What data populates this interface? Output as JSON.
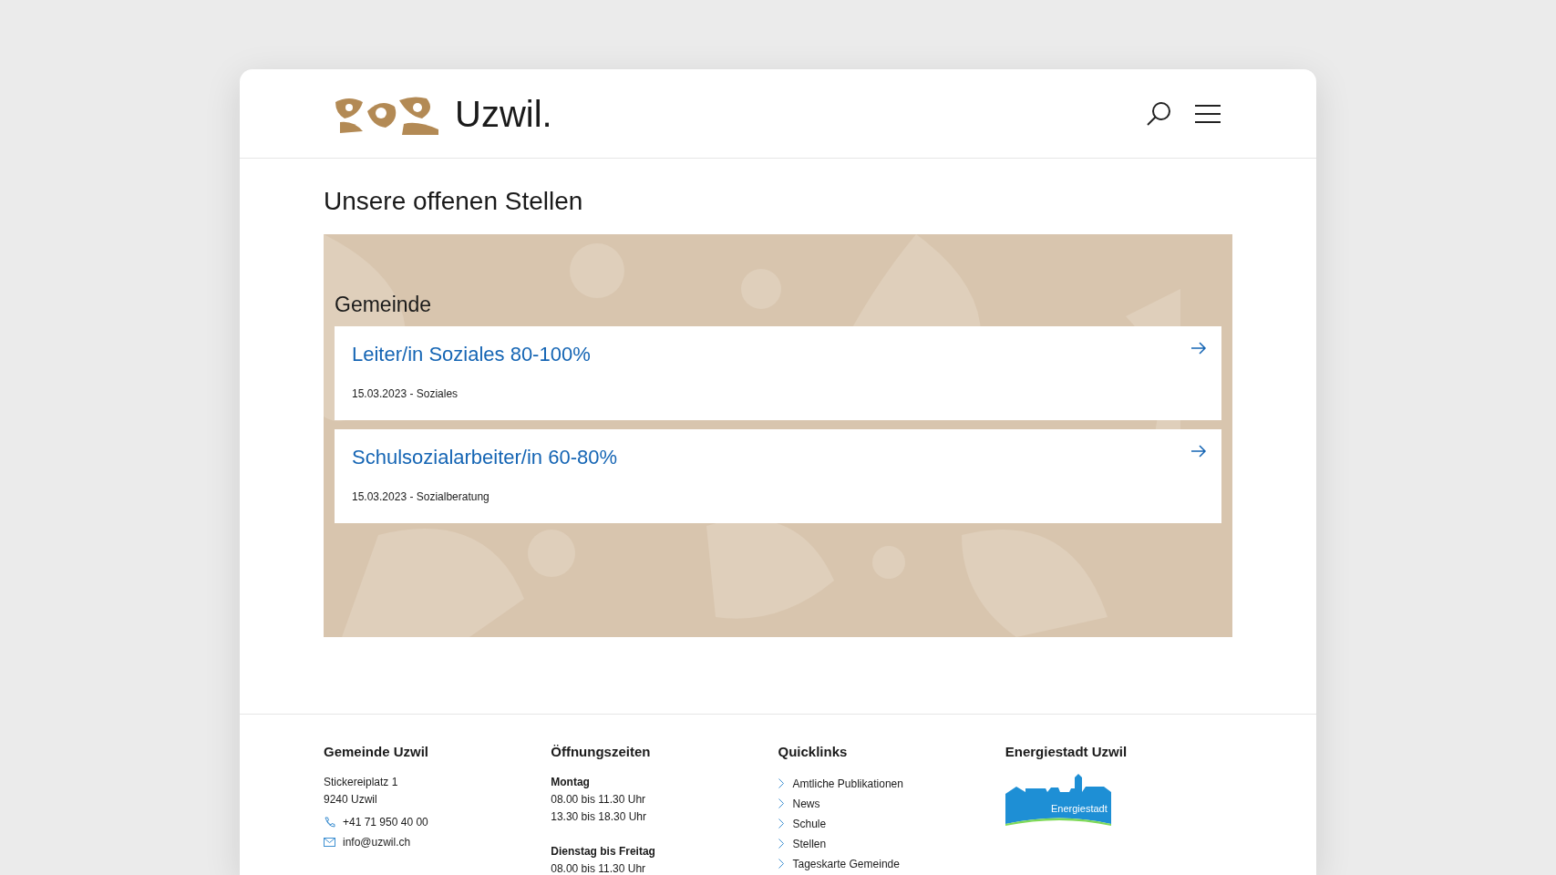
{
  "header": {
    "brand": "Uzwil."
  },
  "page_title": "Unsere offenen Stellen",
  "section": {
    "title": "Gemeinde",
    "jobs": [
      {
        "title": "Leiter/in Soziales 80-100%",
        "meta": "15.03.2023 - Soziales"
      },
      {
        "title": "Schulsozialarbeiter/in 60-80%",
        "meta": "15.03.2023 - Sozialberatung"
      }
    ]
  },
  "footer": {
    "address": {
      "title": "Gemeinde Uzwil",
      "lines": [
        "Stickereiplatz 1",
        "9240 Uzwil"
      ],
      "contacts": [
        {
          "kind": "phone",
          "text": "+41 71 950 40 00"
        },
        {
          "kind": "mail",
          "text": "info@uzwil.ch"
        }
      ]
    },
    "hours": {
      "title": "Öffnungszeiten",
      "groups": [
        {
          "day": "Montag",
          "times": [
            "08.00 bis 11.30 Uhr",
            "13.30 bis 18.30 Uhr"
          ]
        },
        {
          "day": "Dienstag bis Freitag",
          "times": [
            "08.00 bis 11.30 Uhr"
          ]
        }
      ]
    },
    "quicklinks": {
      "title": "Quicklinks",
      "links": [
        "Amtliche Publikationen",
        "News",
        "Schule",
        "Stellen",
        "Tageskarte Gemeinde"
      ]
    },
    "energy": {
      "title": "Energiestadt Uzwil",
      "badge": "Energiestadt"
    }
  }
}
